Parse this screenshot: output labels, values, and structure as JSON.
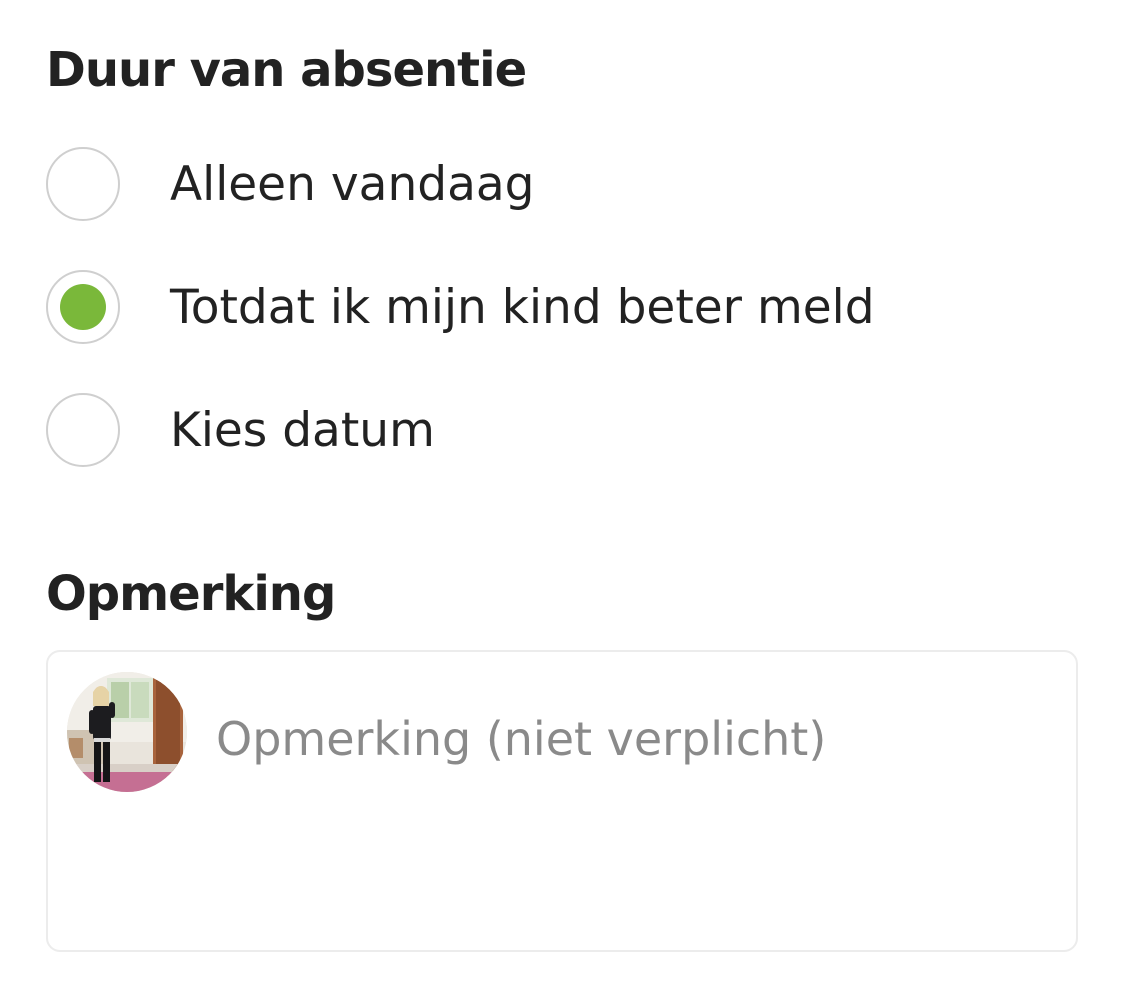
{
  "duration": {
    "title": "Duur van absentie",
    "options": [
      {
        "label": "Alleen vandaag",
        "checked": false
      },
      {
        "label": "Totdat ik mijn kind beter meld",
        "checked": true
      },
      {
        "label": "Kies datum",
        "checked": false
      }
    ]
  },
  "remark": {
    "title": "Opmerking",
    "value": "",
    "placeholder": "Opmerking (niet verplicht)",
    "avatar_icon": "user-avatar-photo"
  },
  "colors": {
    "accent": "#7ab83a",
    "text": "#222222",
    "placeholder": "#8a8a8a",
    "radio_border": "#cfcfcf"
  }
}
